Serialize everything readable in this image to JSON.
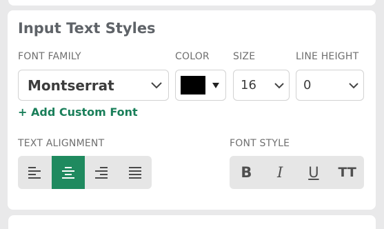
{
  "panel": {
    "title": "Input Text Styles",
    "labels": {
      "font_family": "FONT FAMILY",
      "color": "COLOR",
      "size": "SIZE",
      "line_height": "LINE HEIGHT",
      "text_alignment": "TEXT ALIGNMENT",
      "font_style": "FONT STYLE"
    },
    "font_family_value": "Montserrat",
    "color_value": "#000000",
    "size_value": "16",
    "line_height_value": "0",
    "add_font_link": "+ Add Custom Font",
    "alignment_selected": "center",
    "font_style_buttons": [
      "B",
      "I",
      "U",
      "TT"
    ]
  },
  "colors": {
    "accent": "#1f8a5f",
    "link": "#1a7f5a"
  }
}
